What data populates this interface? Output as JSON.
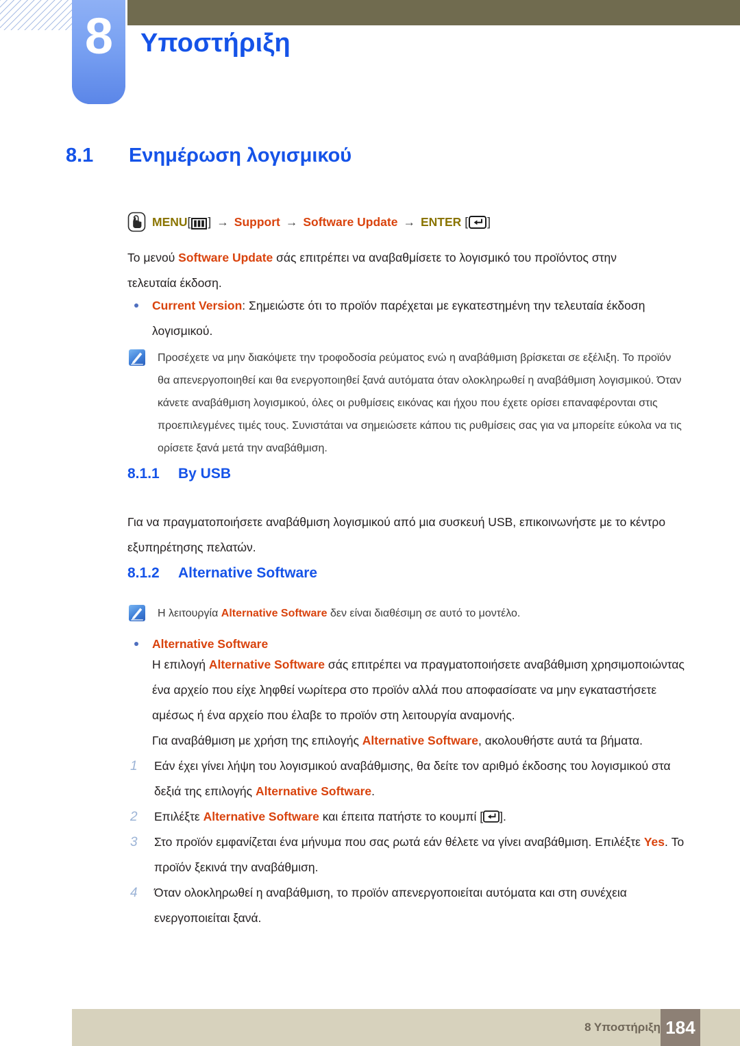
{
  "chapter": {
    "number": "8",
    "title": "Υποστήριξη"
  },
  "colors": {
    "heading_blue": "#1553e8",
    "accent_orange": "#d9430d",
    "menu_olive": "#8a7400",
    "topbar_olive": "#706b4f",
    "tab_blue": "#5b86e8",
    "footer_beige": "#d7d2bd",
    "footer_page_brown": "#8d8075",
    "step_number": "#9bb3d6",
    "bullet_dot": "#4f6fbf"
  },
  "section": {
    "number": "8.1",
    "title": "Ενημέρωση λογισμικού"
  },
  "menu_path": {
    "hand_icon": "hand-press-icon",
    "menu_label": "MENU",
    "menu_icon": "menu-bars-icon",
    "arrow": "→",
    "step_support": "Support",
    "step_software_update": "Software Update",
    "enter_label": "ENTER",
    "enter_icon": "enter-key-icon",
    "bracket_open": "[",
    "bracket_close": "]"
  },
  "intro_paragraph": {
    "pre": "Το μενού ",
    "bold": "Software Update",
    "post": " σάς επιτρέπει να αναβαθμίσετε το λογισμικό του προϊόντος στην τελευταία έκδοση."
  },
  "current_version_bullet": {
    "bold": "Current Version",
    "rest": ": Σημειώστε ότι το προϊόν παρέχεται με εγκατεστημένη την τελευταία έκδοση λογισμικού."
  },
  "note_power": {
    "icon": "note-pen-icon",
    "text": "Προσέχετε να μην διακόψετε την τροφοδοσία ρεύματος ενώ η αναβάθμιση βρίσκεται σε εξέλιξη. Το προϊόν θα απενεργοποιηθεί και θα ενεργοποιηθεί ξανά αυτόματα όταν ολοκληρωθεί η αναβάθμιση λογισμικού. Όταν κάνετε αναβάθμιση λογισμικού, όλες οι ρυθμίσεις εικόνας και ήχου που έχετε ορίσει επαναφέρονται στις προεπιλεγμένες τιμές τους. Συνιστάται να σημειώσετε κάπου τις ρυθμίσεις σας για να μπορείτε εύκολα να τις ορίσετε ξανά μετά την αναβάθμιση."
  },
  "subsection_usb": {
    "number": "8.1.1",
    "title": "By USB",
    "paragraph": "Για να πραγματοποιήσετε αναβάθμιση λογισμικού από μια συσκευή USB, επικοινωνήστε με το κέντρο εξυπηρέτησης πελατών."
  },
  "subsection_alt": {
    "number": "8.1.2",
    "title": "Alternative Software",
    "note": {
      "icon": "note-pen-icon",
      "pre": "Η λειτουργία ",
      "bold": "Alternative Software",
      "post": " δεν είναι διαθέσιμη σε αυτό το μοντέλο."
    },
    "bullet_label": "Alternative Software",
    "paragraph1": {
      "pre": "Η επιλογή ",
      "bold": "Alternative Software",
      "post": " σάς επιτρέπει να πραγματοποιήσετε αναβάθμιση χρησιμοποιώντας ένα αρχείο που είχε ληφθεί νωρίτερα στο προϊόν αλλά που αποφασίσατε να μην εγκαταστήσετε αμέσως ή ένα αρχείο που έλαβε το προϊόν στη λειτουργία αναμονής."
    },
    "paragraph2": {
      "pre": "Για αναβάθμιση με χρήση της επιλογής ",
      "bold": "Alternative Software",
      "post": ", ακολουθήστε αυτά τα βήματα."
    },
    "steps": [
      {
        "number": "1",
        "pre": "Εάν έχει γίνει λήψη του λογισμικού αναβάθμισης, θα δείτε τον αριθμό έκδοσης του λογισμικού στα δεξιά της επιλογής ",
        "bold": "Alternative Software",
        "post": "."
      },
      {
        "number": "2",
        "pre": "Επιλέξτε ",
        "bold": "Alternative Software",
        "post": " και έπειτα πατήστε το κουμπί [",
        "icon": "enter-key-icon",
        "tail": "]."
      },
      {
        "number": "3",
        "pre": "Στο προϊόν εμφανίζεται ένα μήνυμα που σας ρωτά εάν θέλετε να γίνει αναβάθμιση. Επιλέξτε ",
        "bold": "Yes",
        "post": ". Το προϊόν ξεκινά την αναβάθμιση."
      },
      {
        "number": "4",
        "pre": "Όταν ολοκληρωθεί η αναβάθμιση, το προϊόν απενεργοποιείται αυτόματα και στη συνέχεια ενεργοποιείται ξανά.",
        "bold": "",
        "post": ""
      }
    ]
  },
  "footer": {
    "label": "8 Υποστήριξη",
    "page": "184"
  }
}
